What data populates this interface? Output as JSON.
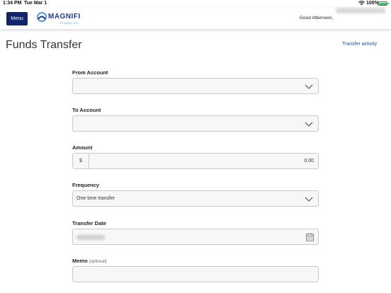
{
  "status_bar": {
    "time": "1:34 PM",
    "date": "Tue Mar 1",
    "battery_percent": "100%",
    "battery_level": 1.0,
    "wifi_icon": "wifi-icon",
    "battery_icon": "battery-icon"
  },
  "header": {
    "menu_label": "Menu",
    "logo_text": "MAGNIFI",
    "logo_subtext": "FINANCIAL",
    "greeting": "Good Afternoon,"
  },
  "page": {
    "title": "Funds Transfer",
    "transfer_activity_link": "Transfer activity"
  },
  "form": {
    "from_account": {
      "label": "From Account",
      "value": ""
    },
    "to_account": {
      "label": "To Account",
      "value": ""
    },
    "amount": {
      "label": "Amount",
      "prefix": "$",
      "value": "0.00"
    },
    "frequency": {
      "label": "Frequency",
      "value": "One time transfer"
    },
    "transfer_date": {
      "label": "Transfer Date"
    },
    "memo": {
      "label": "Memo",
      "optional": "(optional)",
      "value": ""
    }
  },
  "colors": {
    "menu_button_bg": "#12256b",
    "link": "#1f4fa3",
    "logo": "#1d3a8a",
    "field_bg": "#f7f7f8",
    "field_border": "#c9c9c9"
  }
}
